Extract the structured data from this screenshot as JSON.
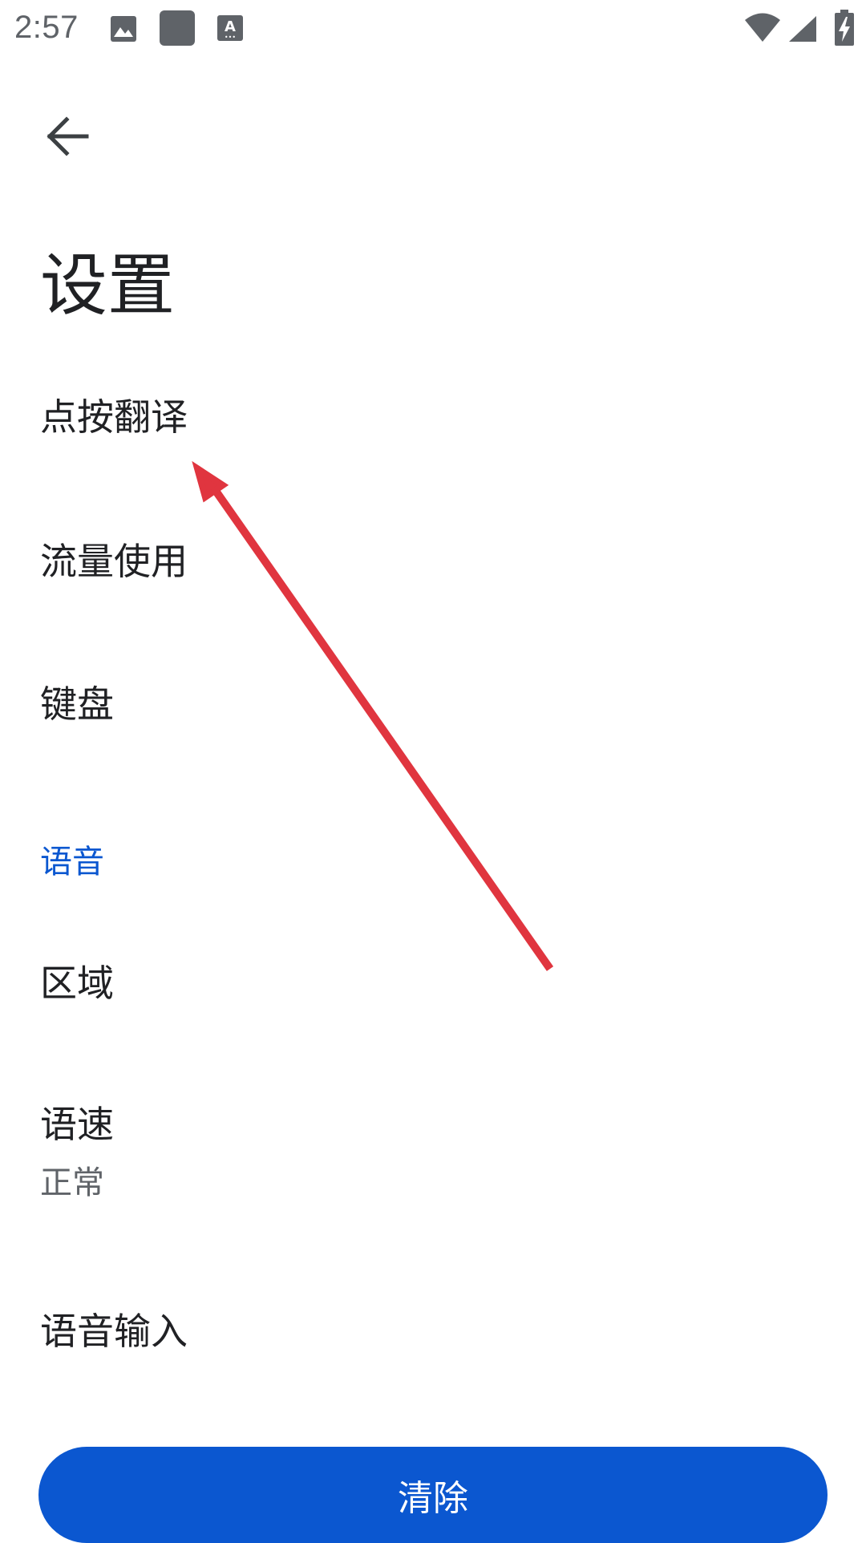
{
  "status_bar": {
    "time": "2:57",
    "icons": [
      "image-icon",
      "app-square-icon",
      "font-download-icon",
      "wifi-icon",
      "cell-signal-icon",
      "battery-charging-icon"
    ]
  },
  "header": {
    "back_icon": "arrow-back-icon",
    "title": "设置"
  },
  "settings": {
    "items": [
      {
        "title": "点按翻译"
      },
      {
        "title": "流量使用"
      },
      {
        "title": "键盘"
      }
    ],
    "voice_section": {
      "header": "语音",
      "items": [
        {
          "title": "区域"
        },
        {
          "title": "语速",
          "summary": "正常"
        },
        {
          "title": "语音输入"
        }
      ]
    }
  },
  "footer": {
    "clear_label": "清除"
  },
  "colors": {
    "accent": "#0b57d0",
    "annotation": "#e0353f",
    "text_primary": "#202124",
    "text_secondary": "#5f6368"
  }
}
